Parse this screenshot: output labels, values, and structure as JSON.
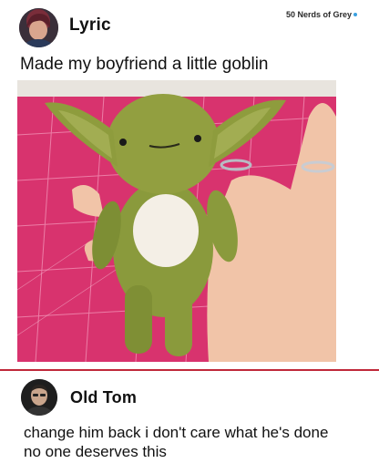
{
  "post": {
    "username": "Lyric",
    "text": "Made my boyfriend a little goblin",
    "image_alt": "green plush goblin toy held in a hand over a pink cutting mat"
  },
  "watermark": {
    "label": "50 Nerds of Grey"
  },
  "reply": {
    "username": "Old Tom",
    "line1": "change him back i don't care what he's done",
    "line2": "no one deserves this"
  },
  "colors": {
    "divider": "#c0283a",
    "mat_pink": "#d8336e",
    "plush_green": "#8a9a3c",
    "belly": "#f4efe6"
  }
}
